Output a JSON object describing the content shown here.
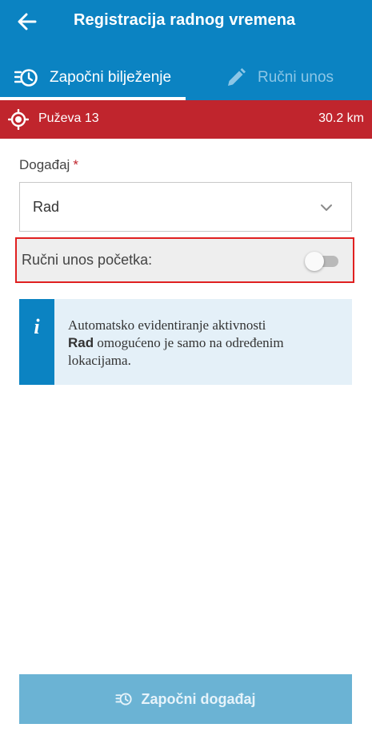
{
  "app": {
    "title": "Registracija radnog vremena",
    "back_icon": "arrow-left-icon"
  },
  "tabs": [
    {
      "label": "Započni bilježenje",
      "icon": "clock-list-icon",
      "active": true
    },
    {
      "label": "Ručni unos",
      "icon": "pencil-icon",
      "active": false
    }
  ],
  "location": {
    "icon": "gps-target-icon",
    "name": "Puževa 13",
    "distance": "30.2 km"
  },
  "form": {
    "event_label": "Događaj",
    "required_marker": "*",
    "event_value": "Rad",
    "manual_start_label": "Ručni unos početka:",
    "manual_start_enabled": false
  },
  "info": {
    "icon_glyph": "i",
    "text_before": "Automatsko evidentiranje aktivnosti",
    "highlight": "Rad",
    "text_after": "omogućeno je samo na određenim lokacijama."
  },
  "actions": {
    "start_label": "Započni događaj",
    "start_icon": "clock-list-icon"
  },
  "colors": {
    "primary": "#0b83c2",
    "location_bar": "#c0252d",
    "highlight_border": "#e02020",
    "button_disabled": "#6bb3d4"
  }
}
